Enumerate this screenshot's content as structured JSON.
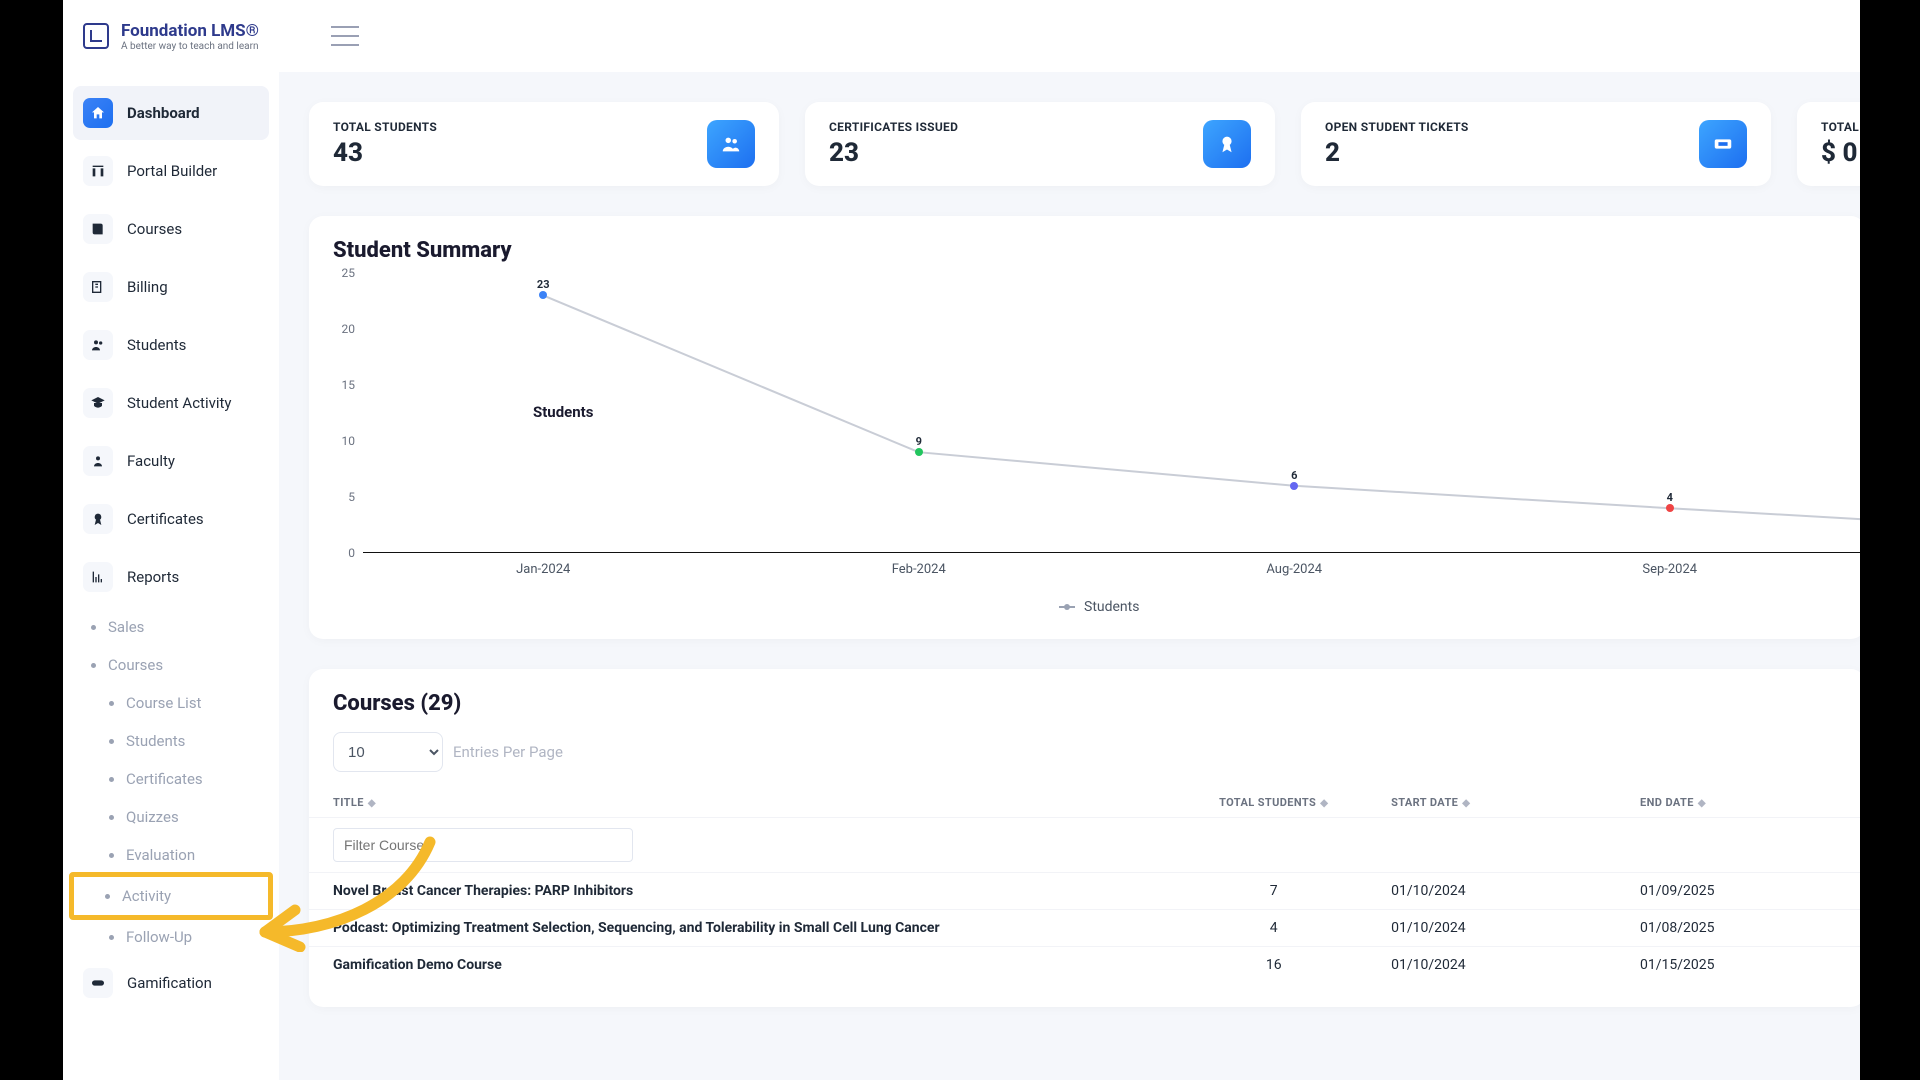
{
  "brand": {
    "name": "Foundation LMS®",
    "tagline": "A better way to teach and learn"
  },
  "sidebar": {
    "items": [
      {
        "label": "Dashboard"
      },
      {
        "label": "Portal Builder"
      },
      {
        "label": "Courses"
      },
      {
        "label": "Billing"
      },
      {
        "label": "Students"
      },
      {
        "label": "Student Activity"
      },
      {
        "label": "Faculty"
      },
      {
        "label": "Certificates"
      },
      {
        "label": "Reports"
      }
    ],
    "reports_sub": [
      {
        "label": "Sales"
      },
      {
        "label": "Courses"
      }
    ],
    "courses_sub": [
      {
        "label": "Course List"
      },
      {
        "label": "Students"
      },
      {
        "label": "Certificates"
      },
      {
        "label": "Quizzes"
      },
      {
        "label": "Evaluation"
      },
      {
        "label": "Activity"
      },
      {
        "label": "Follow-Up"
      }
    ],
    "footer_item": {
      "label": "Gamification"
    }
  },
  "stats": [
    {
      "label": "TOTAL STUDENTS",
      "value": "43"
    },
    {
      "label": "CERTIFICATES ISSUED",
      "value": "23"
    },
    {
      "label": "OPEN STUDENT TICKETS",
      "value": "2"
    },
    {
      "label": "TOTAL",
      "value": "$ 0"
    }
  ],
  "chart_section": {
    "title": "Student Summary",
    "legend": "Students",
    "series_label": "Students"
  },
  "chart_data": {
    "type": "line",
    "title": "Student Summary",
    "ylabel": "",
    "xlabel": "",
    "ylim": [
      0,
      25
    ],
    "y_ticks": [
      0,
      5,
      10,
      15,
      20,
      25
    ],
    "categories": [
      "Jan-2024",
      "Feb-2024",
      "Aug-2024",
      "Sep-2024"
    ],
    "series": [
      {
        "name": "Students",
        "values": [
          23,
          9,
          6,
          4
        ]
      }
    ],
    "point_colors": [
      "#3b82f6",
      "#22c55e",
      "#6366f1",
      "#ef4444"
    ]
  },
  "courses_section": {
    "title": "Courses (29)",
    "entries_value": "10",
    "entries_label": "Entries Per Page",
    "columns": [
      "TITLE",
      "TOTAL STUDENTS",
      "START DATE",
      "END DATE"
    ],
    "filter_placeholder": "Filter Course",
    "rows": [
      {
        "title": "Novel Breast Cancer Therapies: PARP Inhibitors",
        "total": "7",
        "start": "01/10/2024",
        "end": "01/09/2025"
      },
      {
        "title": "Podcast: Optimizing Treatment Selection, Sequencing, and Tolerability in Small Cell Lung Cancer",
        "total": "4",
        "start": "01/10/2024",
        "end": "01/08/2025"
      },
      {
        "title": "Gamification Demo Course",
        "total": "16",
        "start": "01/10/2024",
        "end": "01/15/2025"
      }
    ]
  }
}
